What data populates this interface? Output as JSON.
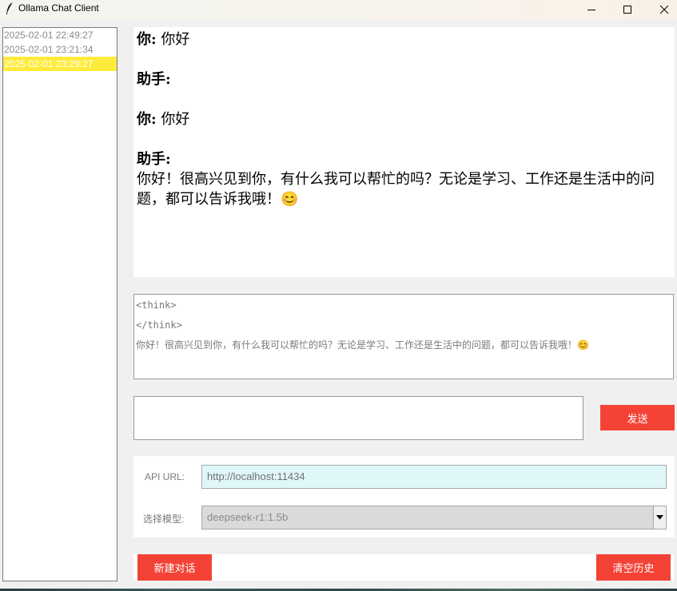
{
  "window": {
    "title": "Ollama Chat Client",
    "icon": "feather-icon",
    "controls": [
      "minimize-icon",
      "maximize-icon",
      "close-icon"
    ]
  },
  "sessions": [
    {
      "label": "2025-02-01 22:49:27",
      "selected": false
    },
    {
      "label": "2025-02-01 23:21:34",
      "selected": false
    },
    {
      "label": "2025-02-01 23:29:27",
      "selected": true
    }
  ],
  "chat": {
    "messages": [
      {
        "speaker": "你:",
        "text": "你好"
      },
      {
        "speaker": "助手:",
        "text": ""
      },
      {
        "speaker": "你:",
        "text": "你好"
      },
      {
        "speaker": "助手:",
        "text": "你好！很高兴见到你，有什么我可以帮忙的吗？无论是学习、工作还是生活中的问题，都可以告诉我哦！😊"
      }
    ]
  },
  "raw_output": {
    "lines": [
      "<think>",
      "</think>",
      "你好！很高兴见到你，有什么我可以帮忙的吗？无论是学习、工作还是生活中的问题，都可以告诉我哦！😊"
    ]
  },
  "input": {
    "value": "",
    "send_label": "发送"
  },
  "settings": {
    "api_url_label": "API URL:",
    "api_url_value": "http://localhost:11434",
    "model_label": "选择模型:",
    "model_value": "deepseek-r1:1.5b"
  },
  "actions": {
    "new_chat_label": "新建对话",
    "clear_history_label": "清空历史"
  },
  "colors": {
    "accent_red": "#f44336",
    "selected_session": "#ffeb3b",
    "url_field_bg": "#e0f7fa"
  }
}
